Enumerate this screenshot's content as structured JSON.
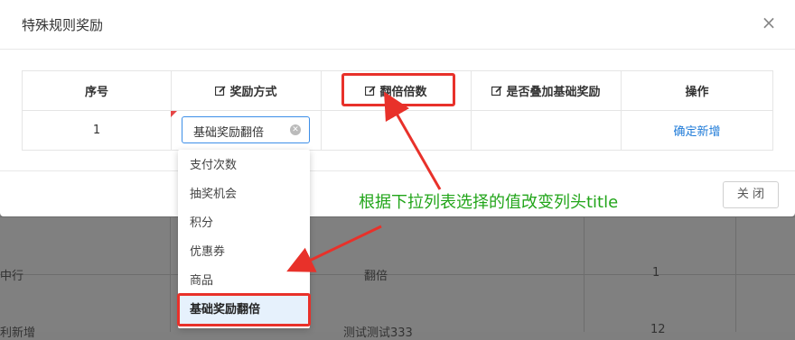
{
  "background_table": {
    "row1": {
      "col0": "中行",
      "col1": "翻倍",
      "col3": "1"
    },
    "row2": {
      "col0": "利新增",
      "col1": "测试测试333",
      "col3": "12"
    }
  },
  "modal": {
    "title": "特殊规则奖励",
    "close_icon": "×",
    "columns": [
      "序号",
      "奖励方式",
      "翻倍倍数",
      "是否叠加基础奖励",
      "操作"
    ],
    "row": {
      "index": "1",
      "reward_select_value": "基础奖励翻倍",
      "action_link": "确定新增"
    },
    "footer_close": "关 闭"
  },
  "dropdown": {
    "options": [
      "支付次数",
      "抽奖机会",
      "积分",
      "优惠券",
      "商品",
      "基础奖励翻倍"
    ],
    "selected": "基础奖励翻倍"
  },
  "annotation": {
    "text": "根据下拉列表选择的值改变列头title",
    "color": "#22a51a",
    "highlight_color": "#e8312a"
  },
  "icons": {
    "edit": "edit-icon",
    "clear": "clear-icon",
    "close": "close-icon"
  }
}
